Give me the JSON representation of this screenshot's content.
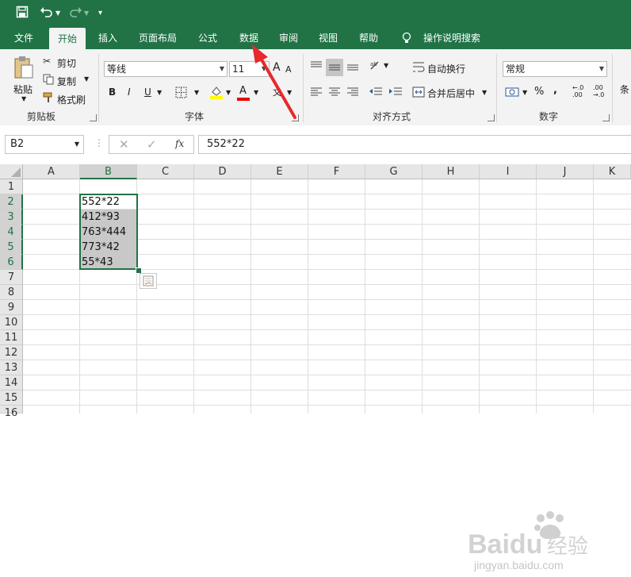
{
  "tabs": [
    "文件",
    "开始",
    "插入",
    "页面布局",
    "公式",
    "数据",
    "审阅",
    "视图",
    "帮助"
  ],
  "tell_me": "操作说明搜索",
  "clipboard": {
    "paste": "粘贴",
    "cut": "剪切",
    "copy": "复制",
    "format_painter": "格式刷",
    "group": "剪贴板"
  },
  "font": {
    "name": "等线",
    "size": "11",
    "group": "字体",
    "bold": "B",
    "italic": "I",
    "underline": "U",
    "font_color_letter": "A",
    "grow": "A",
    "shrink": "A",
    "phonetic": "文"
  },
  "alignment": {
    "wrap_text": "自动换行",
    "merge_center": "合并后居中",
    "group": "对齐方式"
  },
  "number": {
    "format": "常规",
    "group": "数字",
    "percent": "%",
    "comma": ",",
    "inc_decimal": ".00",
    "dec_decimal": ".0"
  },
  "cut_off_group": "条",
  "formula_bar": {
    "name_box": "B2",
    "fx": "fx",
    "formula": "552*22"
  },
  "columns": [
    "A",
    "B",
    "C",
    "D",
    "E",
    "F",
    "G",
    "H",
    "I",
    "J",
    "K"
  ],
  "rows": [
    "1",
    "2",
    "3",
    "4",
    "5",
    "6",
    "7",
    "8",
    "9",
    "10",
    "11",
    "12",
    "13",
    "14",
    "15",
    "16"
  ],
  "cells_B": [
    "552*22",
    "412*93",
    "763*444",
    "773*42",
    "55*43"
  ],
  "watermark": {
    "brand": "Baidu",
    "sub": "经验",
    "url": "jingyan.baidu.com"
  },
  "colors": {
    "accent": "#217346",
    "arrow": "#e8282b",
    "selection_shade": "#c8c8c8"
  }
}
